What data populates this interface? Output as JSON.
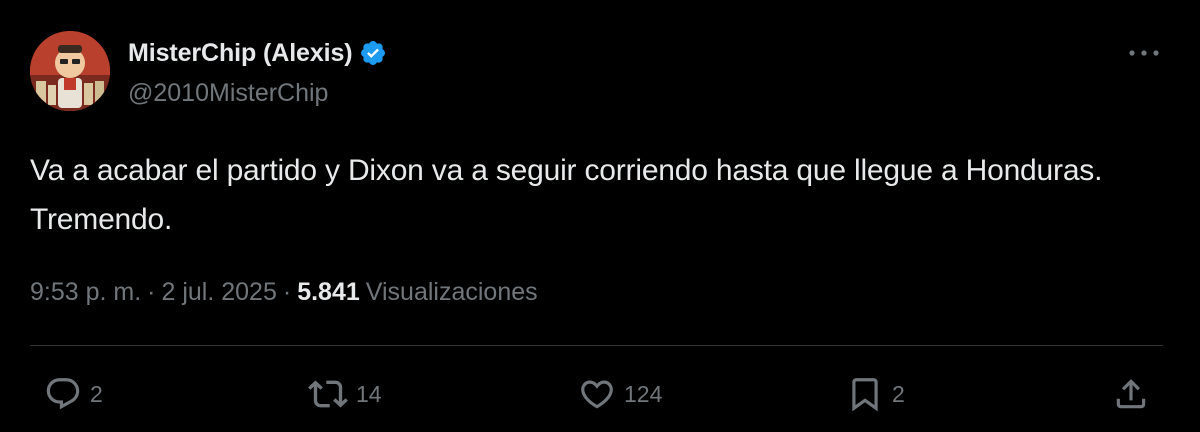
{
  "author": {
    "display_name": "MisterChip (Alexis)",
    "handle": "@2010MisterChip",
    "verified": true
  },
  "tweet": {
    "text": "Va a acabar el partido y Dixon va a seguir corriendo hasta que llegue a Honduras. Tremendo."
  },
  "meta": {
    "time": "9:53 p. m.",
    "separator": "·",
    "date": "2 jul. 2025",
    "views_count": "5.841",
    "views_label": "Visualizaciones"
  },
  "actions": {
    "replies": "2",
    "retweets": "14",
    "likes": "124",
    "bookmarks": "2"
  },
  "icons": {
    "verified": "verified-badge-icon",
    "more": "more-horizontal-icon",
    "reply": "reply-icon",
    "retweet": "retweet-icon",
    "like": "heart-icon",
    "bookmark": "bookmark-icon",
    "share": "share-icon"
  },
  "colors": {
    "background": "#000000",
    "primary_text": "#e7e9ea",
    "secondary_text": "#71767b",
    "verified_blue": "#1d9bf0",
    "divider": "#2f3336"
  }
}
